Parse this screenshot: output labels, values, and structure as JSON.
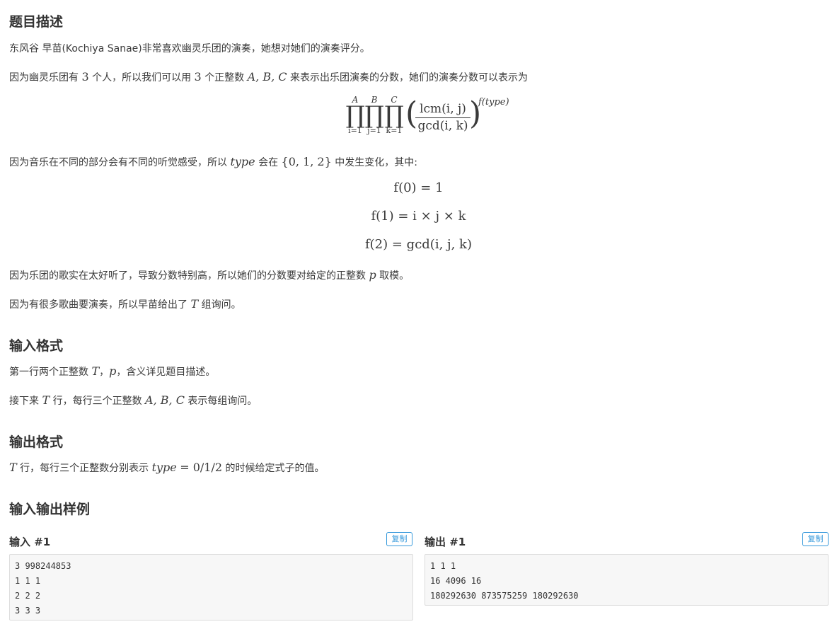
{
  "sections": {
    "description": "题目描述",
    "input_format": "输入格式",
    "output_format": "输出格式",
    "samples": "输入输出样例"
  },
  "description": {
    "p1": "东风谷 早苗(Kochiya Sanae)非常喜欢幽灵乐团的演奏，她想对她们的演奏评分。",
    "p2_a": "因为幽灵乐团有",
    "p2_n1": "3",
    "p2_b": "个人，所以我们可以用",
    "p2_n2": "3",
    "p2_c": "个正整数",
    "p2_vars": "A, B, C",
    "p2_d": "来表示出乐团演奏的分数，她们的演奏分数可以表示为",
    "formula": {
      "ub1": "A",
      "ub2": "B",
      "ub3": "C",
      "lb1": "i=1",
      "lb2": "j=1",
      "lb3": "k=1",
      "num": "lcm(i, j)",
      "den": "gcd(i, k)",
      "exp": "f(type)"
    },
    "p3_a": "因为音乐在不同的部分会有不同的听觉感受，所以",
    "p3_type": "type",
    "p3_b": "会在",
    "p3_set": "{0, 1, 2}",
    "p3_c": "中发生变化，其中:",
    "eq1": "f(0) = 1",
    "eq2": "f(1) = i × j × k",
    "eq3": "f(2) = gcd(i, j, k)",
    "p4_a": "因为乐团的歌实在太好听了，导致分数特别高，所以她们的分数要对给定的正整数",
    "p4_p": "p",
    "p4_b": "取模。",
    "p5_a": "因为有很多歌曲要演奏，所以早苗给出了",
    "p5_T": "T",
    "p5_b": "组询问。"
  },
  "input": {
    "l1_a": "第一行两个正整数",
    "l1_T": "T",
    "l1_sep": "，",
    "l1_p": "p",
    "l1_b": "，含义详见题目描述。",
    "l2_a": "接下来",
    "l2_T": "T",
    "l2_b": "行，每行三个正整数",
    "l2_vars": "A, B, C",
    "l2_c": "表示每组询问。"
  },
  "output": {
    "T": "T",
    "a": "行，每行三个正整数分别表示",
    "type": "type",
    "eq": "= 0/1/2",
    "b": "的时候给定式子的值。"
  },
  "samples": {
    "input_title": "输入 #1",
    "output_title": "输出 #1",
    "copy_label": "复制",
    "input_lines": [
      "3 998244853",
      "1 1 1",
      "2 2 2",
      "3 3 3"
    ],
    "output_lines": [
      "1 1 1",
      "16 4096 16",
      "180292630 873575259 180292630"
    ]
  },
  "colors": {
    "accent": "#3498db",
    "code_bg": "#f7f7f7"
  }
}
